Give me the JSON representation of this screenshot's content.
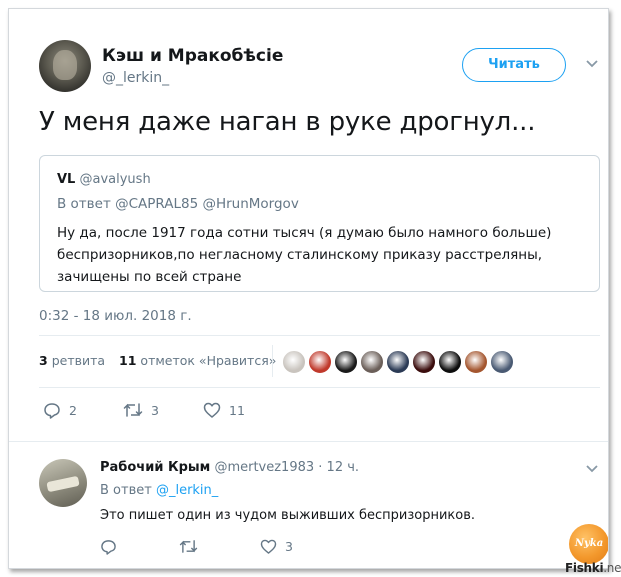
{
  "tweet": {
    "author_name": "Кэш и Мракобѣсіе",
    "author_handle": "@_lerkin_",
    "follow_label": "Читать",
    "text": "У меня даже наган в руке дрогнул...",
    "quote": {
      "author_name": "VL",
      "author_handle": "@avalyush",
      "reply_line": "В ответ @CAPRAL85 @HrunMorgov",
      "body": "Ну да,  после 1917 года сотни тысяч (я думаю было намного больше) беспризорников,по негласному сталинскому приказу расстреляны, зачищены по всей стране"
    },
    "timestamp": "0:32 - 18 июл. 2018 г.",
    "stats": {
      "retweets_count": "3",
      "retweets_label": "ретвита",
      "likes_count": "11",
      "likes_label": "отметок «Нравится»"
    },
    "likers": [
      {
        "color": "#c9c4be"
      },
      {
        "color": "#c0392b"
      },
      {
        "color": "#1a1a1a"
      },
      {
        "color": "#6b5f59"
      },
      {
        "color": "#2b3a55"
      },
      {
        "color": "#3b0d0d"
      },
      {
        "color": "#0d0d0d"
      },
      {
        "color": "#a4562f"
      },
      {
        "color": "#4a5a73"
      }
    ],
    "actions": {
      "reply_count": "2",
      "retweet_count": "3",
      "like_count": "11"
    }
  },
  "reply": {
    "author_name": "Рабочий Крым",
    "author_handle": "@mertvez1983",
    "time": "· 12 ч.",
    "reply_to_prefix": "В ответ",
    "reply_to_handle": "@_lerkin_",
    "body": "Это пишет один из чудом выживших беспризорников.",
    "actions": {
      "like_count": "3"
    }
  },
  "watermark": {
    "badge": "Nyka",
    "site": "Fishki",
    "tld": ".net"
  },
  "colors": {
    "accent": "#1da1f2",
    "secondary_text": "#657786",
    "divider": "#e6ecf0"
  }
}
